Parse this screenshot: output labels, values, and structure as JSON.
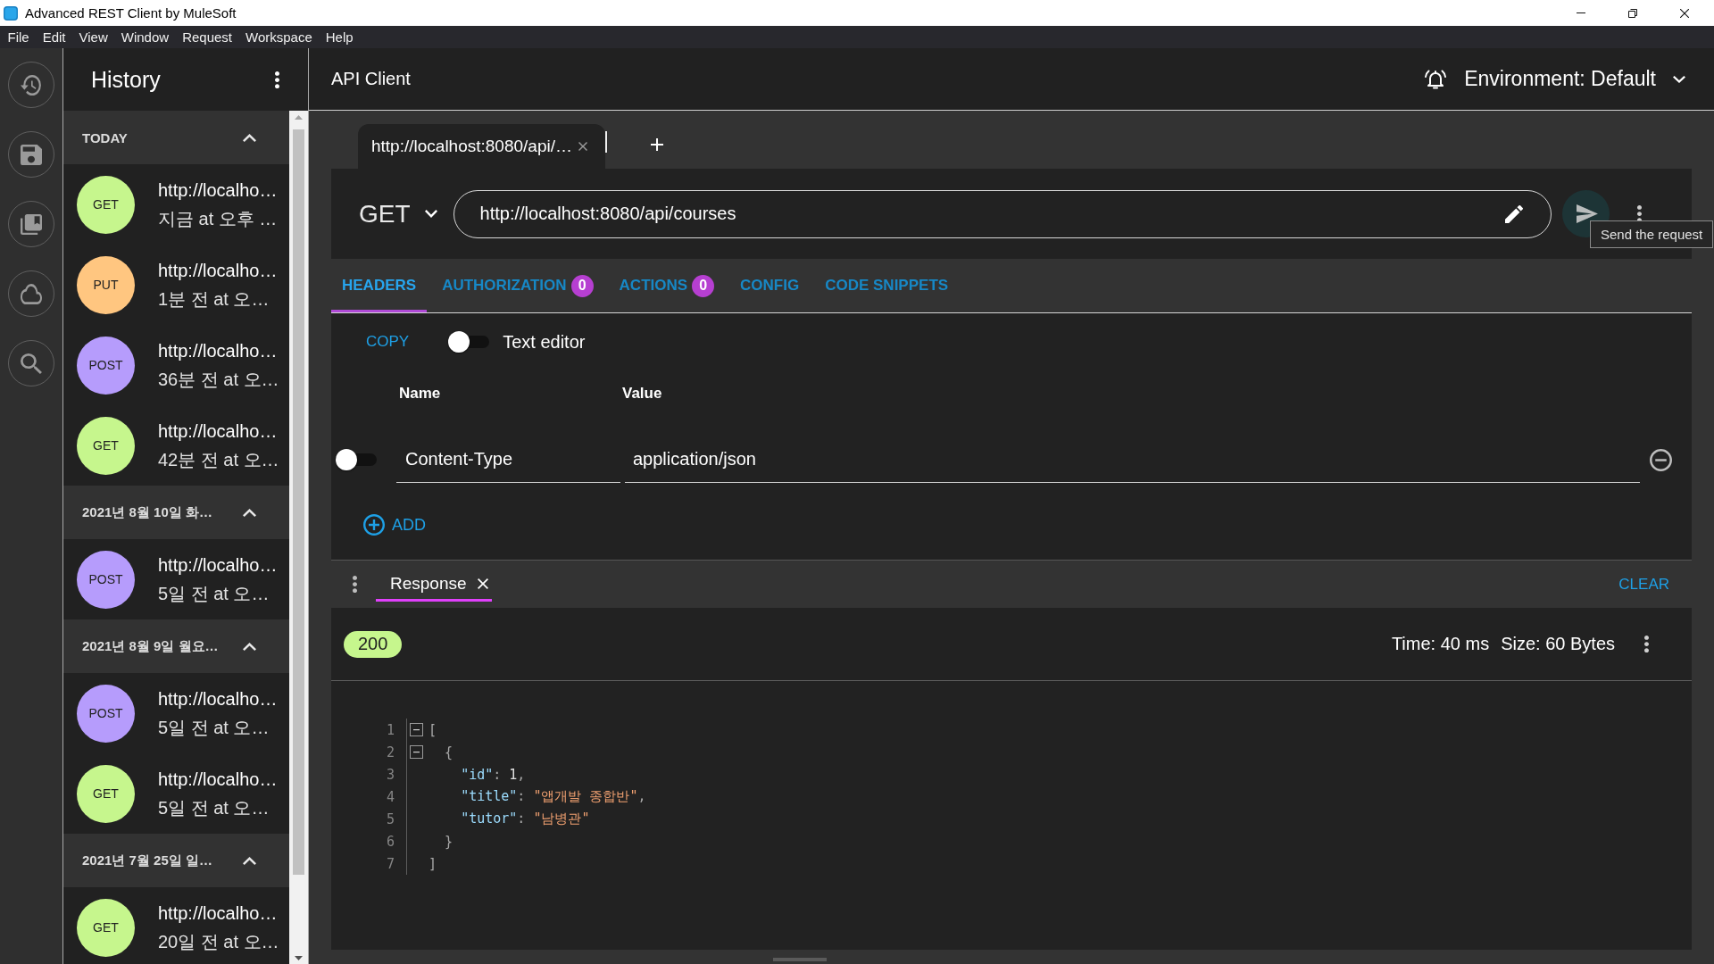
{
  "window": {
    "title": "Advanced REST Client by MuleSoft"
  },
  "menu": [
    "File",
    "Edit",
    "View",
    "Window",
    "Request",
    "Workspace",
    "Help"
  ],
  "history": {
    "title": "History",
    "sections": [
      {
        "label": "TODAY",
        "expanded": true,
        "items": [
          {
            "method": "GET",
            "color": "#c6f68d",
            "url": "http://localho…",
            "time": "지금 at 오후 …"
          },
          {
            "method": "PUT",
            "color": "#ffc680",
            "url": "http://localho…",
            "time": "1분 전 at 오…"
          },
          {
            "method": "POST",
            "color": "#b69cfc",
            "url": "http://localho…",
            "time": "36분 전 at 오…"
          },
          {
            "method": "GET",
            "color": "#c6f68d",
            "url": "http://localho…",
            "time": "42분 전 at 오…"
          }
        ]
      },
      {
        "label": "2021년 8월 10일 화…",
        "expanded": true,
        "items": [
          {
            "method": "POST",
            "color": "#b69cfc",
            "url": "http://localho…",
            "time": "5일 전 at 오…"
          }
        ]
      },
      {
        "label": "2021년 8월 9일 월요…",
        "expanded": true,
        "items": [
          {
            "method": "POST",
            "color": "#b69cfc",
            "url": "http://localho…",
            "time": "5일 전 at 오…"
          },
          {
            "method": "GET",
            "color": "#c6f68d",
            "url": "http://localho…",
            "time": "5일 전 at 오…"
          }
        ]
      },
      {
        "label": "2021년 7월 25일 일…",
        "expanded": true,
        "items": [
          {
            "method": "GET",
            "color": "#c6f68d",
            "url": "http://localho…",
            "time": "20일 전 at 오…"
          }
        ]
      }
    ]
  },
  "header": {
    "title": "API Client",
    "environment": "Environment: Default"
  },
  "request_tabs": [
    {
      "label": "http://localhost:8080/api/…",
      "selected": true
    }
  ],
  "request": {
    "method": "GET",
    "url": "http://localhost:8080/api/courses",
    "tooltip": "Send the request"
  },
  "editor_tabs": [
    {
      "label": "HEADERS",
      "selected": true
    },
    {
      "label": "AUTHORIZATION",
      "badge": "0",
      "selected": false
    },
    {
      "label": "ACTIONS",
      "badge": "0",
      "selected": false
    },
    {
      "label": "CONFIG",
      "selected": false
    },
    {
      "label": "CODE SNIPPETS",
      "selected": false
    }
  ],
  "headers_editor": {
    "copy": "COPY",
    "text_editor": {
      "label": "Text editor",
      "on": false
    },
    "columns": [
      "Name",
      "Value"
    ],
    "rows": [
      {
        "enabled": false,
        "name": "Content-Type",
        "value": "application/json"
      }
    ],
    "add": "ADD"
  },
  "response": {
    "tabs": [
      {
        "label": "Response",
        "selected": true
      }
    ],
    "clear": "CLEAR",
    "status": "200",
    "time": "Time: 40 ms",
    "size": "Size: 60 Bytes",
    "lines": [
      {
        "number": "1",
        "foldable": true,
        "tokens": [
          {
            "kind": "punct",
            "text": "["
          }
        ]
      },
      {
        "number": "2",
        "foldable": true,
        "tokens": [
          {
            "kind": "punct",
            "text": "  {"
          }
        ]
      },
      {
        "number": "3",
        "foldable": false,
        "tokens": [
          {
            "kind": "key",
            "text": "    \"id\""
          },
          {
            "kind": "punct",
            "text": ": "
          },
          {
            "kind": "number",
            "text": "1"
          },
          {
            "kind": "punct",
            "text": ","
          }
        ]
      },
      {
        "number": "4",
        "foldable": false,
        "tokens": [
          {
            "kind": "key",
            "text": "    \"title\""
          },
          {
            "kind": "punct",
            "text": ": "
          },
          {
            "kind": "string",
            "text": "\"앱개발 종합반\""
          },
          {
            "kind": "punct",
            "text": ","
          }
        ]
      },
      {
        "number": "5",
        "foldable": false,
        "tokens": [
          {
            "kind": "key",
            "text": "    \"tutor\""
          },
          {
            "kind": "punct",
            "text": ": "
          },
          {
            "kind": "string",
            "text": "\"남병관\""
          }
        ]
      },
      {
        "number": "6",
        "foldable": false,
        "tokens": [
          {
            "kind": "punct",
            "text": "  }"
          }
        ]
      },
      {
        "number": "7",
        "foldable": false,
        "tokens": [
          {
            "kind": "punct",
            "text": "]"
          }
        ]
      }
    ]
  }
}
